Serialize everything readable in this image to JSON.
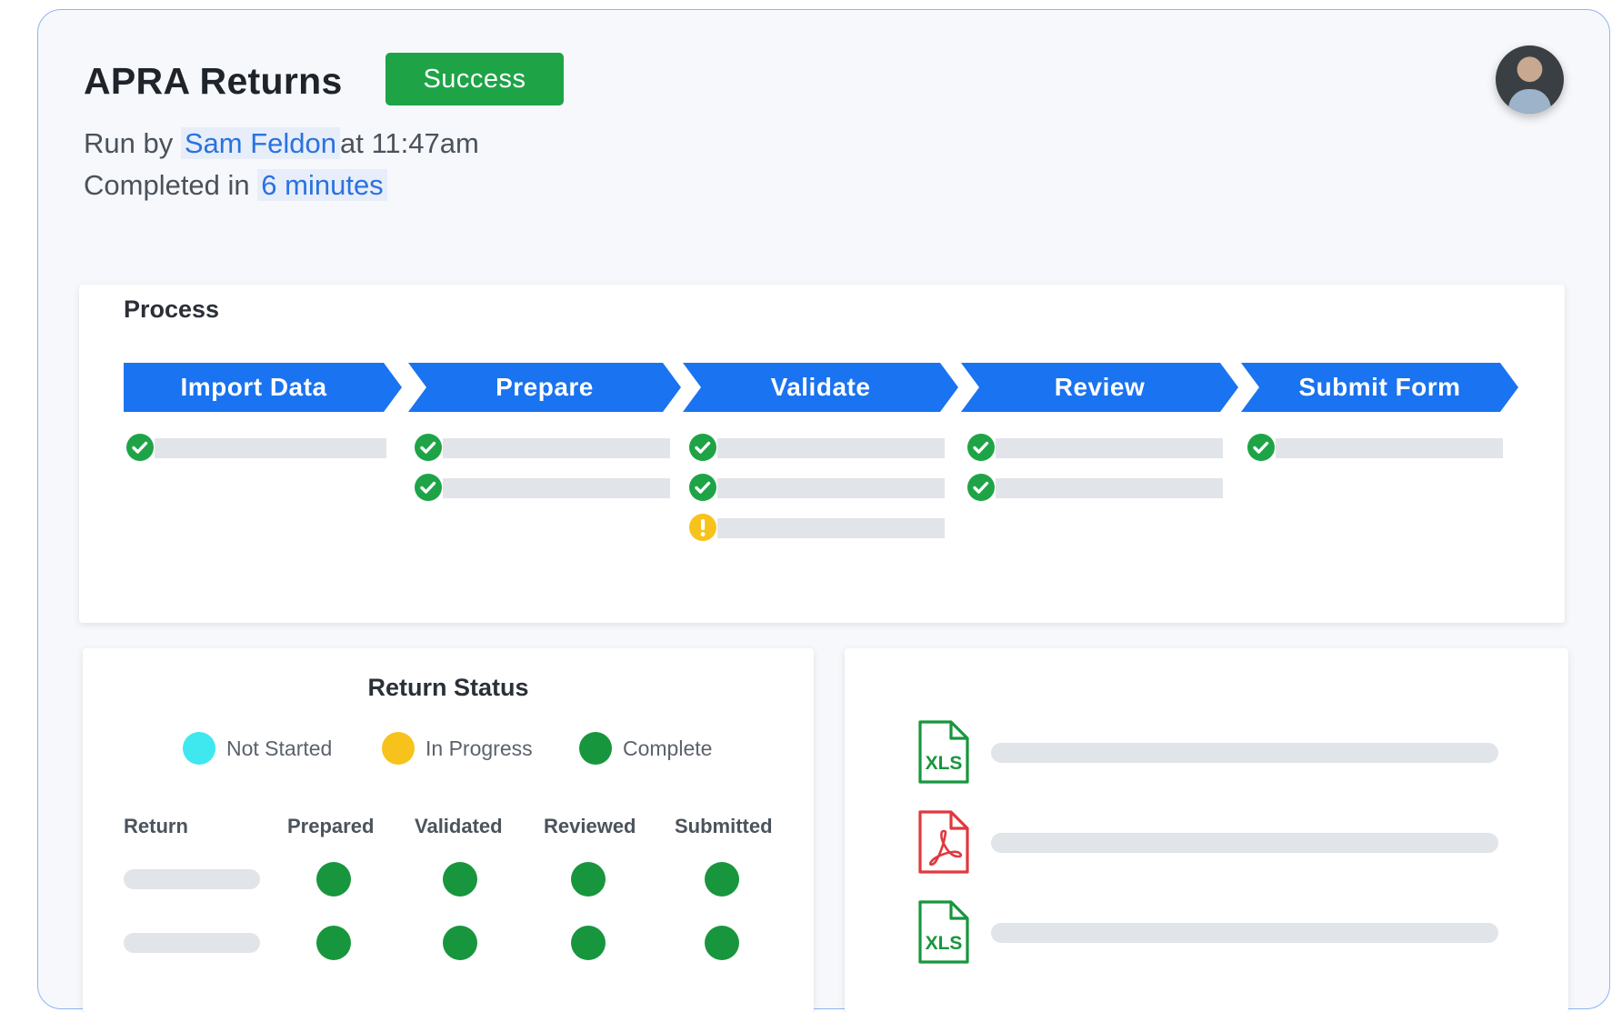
{
  "header": {
    "title": "APRA Returns",
    "status_badge": "Success",
    "run_prefix": "Run by",
    "run_user": "Sam Feldon",
    "run_time": "at 11:47am",
    "completed_prefix": "Completed in",
    "completed_duration": "6 minutes"
  },
  "process": {
    "title": "Process",
    "steps": [
      {
        "label": "Import Data",
        "items": [
          "complete"
        ]
      },
      {
        "label": "Prepare",
        "items": [
          "complete",
          "complete"
        ]
      },
      {
        "label": "Validate",
        "items": [
          "complete",
          "complete",
          "warning"
        ]
      },
      {
        "label": "Review",
        "items": [
          "complete",
          "complete"
        ]
      },
      {
        "label": "Submit Form",
        "items": [
          "complete"
        ]
      }
    ]
  },
  "return_status": {
    "title": "Return Status",
    "legend": [
      {
        "label": "Not Started",
        "color": "#3ee8ee"
      },
      {
        "label": "In Progress",
        "color": "#f7c21b"
      },
      {
        "label": "Complete",
        "color": "#18963d"
      }
    ],
    "columns": [
      "Return",
      "Prepared",
      "Validated",
      "Reviewed",
      "Submitted"
    ],
    "rows": [
      {
        "statuses": [
          "Complete",
          "Complete",
          "Complete",
          "Complete"
        ]
      },
      {
        "statuses": [
          "Complete",
          "Complete",
          "Complete",
          "Complete"
        ]
      }
    ]
  },
  "files": [
    {
      "type": "xls",
      "icon": "xls-file-icon",
      "label": "XLS",
      "color": "#18963d"
    },
    {
      "type": "pdf",
      "icon": "pdf-file-icon",
      "label": "",
      "color": "#e0393e"
    },
    {
      "type": "xls",
      "icon": "xls-file-icon",
      "label": "XLS",
      "color": "#18963d"
    }
  ],
  "colors": {
    "accent": "#1a73f0",
    "success": "#1ea447",
    "warning": "#f7c21b"
  }
}
